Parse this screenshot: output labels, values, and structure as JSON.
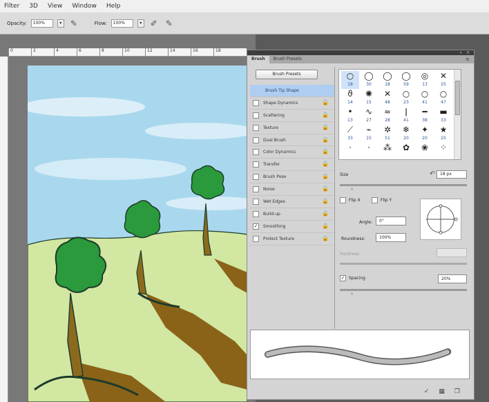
{
  "menubar": {
    "items": [
      "Filter",
      "3D",
      "View",
      "Window",
      "Help"
    ]
  },
  "optionsbar": {
    "opacity_label": "Opacity:",
    "opacity_value": "100%",
    "flow_label": "Flow:",
    "flow_value": "100%"
  },
  "ruler": {
    "marks": [
      "0",
      "2",
      "4",
      "6",
      "8",
      "10",
      "12",
      "14",
      "16",
      "18"
    ]
  },
  "panel": {
    "tabs": [
      "Brush",
      "Brush Presets"
    ],
    "presets_button": "Brush Presets",
    "settings": [
      {
        "label": "Brush Tip Shape",
        "checked": false,
        "lock": false,
        "selected": true
      },
      {
        "label": "Shape Dynamics",
        "checked": false,
        "lock": true
      },
      {
        "label": "Scattering",
        "checked": false,
        "lock": true
      },
      {
        "label": "Texture",
        "checked": false,
        "lock": true
      },
      {
        "label": "Dual Brush",
        "checked": false,
        "lock": true
      },
      {
        "label": "Color Dynamics",
        "checked": false,
        "lock": true
      },
      {
        "label": "Transfer",
        "checked": false,
        "lock": true
      },
      {
        "label": "Brush Pose",
        "checked": false,
        "lock": true
      },
      {
        "label": "Noise",
        "checked": false,
        "lock": true
      },
      {
        "label": "Wet Edges",
        "checked": false,
        "lock": true
      },
      {
        "label": "Build-up",
        "checked": false,
        "lock": true
      },
      {
        "label": "Smoothing",
        "checked": true,
        "lock": true
      },
      {
        "label": "Protect Texture",
        "checked": false,
        "lock": true
      }
    ],
    "tips": [
      {
        "g": "○",
        "n": "18"
      },
      {
        "g": "◯",
        "n": "30"
      },
      {
        "g": "◯",
        "n": "18"
      },
      {
        "g": "◯",
        "n": "59"
      },
      {
        "g": "◎",
        "n": "13"
      },
      {
        "g": "✕",
        "n": "25"
      },
      {
        "g": "ϑ",
        "n": "14"
      },
      {
        "g": "✺",
        "n": "15"
      },
      {
        "g": "✕",
        "n": "48"
      },
      {
        "g": "○",
        "n": "23"
      },
      {
        "g": "○",
        "n": "41"
      },
      {
        "g": "○",
        "n": "47"
      },
      {
        "g": "•",
        "n": "13"
      },
      {
        "g": "∿",
        "n": "27"
      },
      {
        "g": "≈",
        "n": "28"
      },
      {
        "g": "ǀ",
        "n": "41"
      },
      {
        "g": "━",
        "n": "38"
      },
      {
        "g": "▬",
        "n": "33"
      },
      {
        "g": "⟋",
        "n": "33"
      },
      {
        "g": "⌁",
        "n": "15"
      },
      {
        "g": "✲",
        "n": "51"
      },
      {
        "g": "❄",
        "n": "20"
      },
      {
        "g": "✦",
        "n": "20"
      },
      {
        "g": "★",
        "n": "25"
      },
      {
        "g": "·",
        "n": ""
      },
      {
        "g": "·",
        "n": ""
      },
      {
        "g": "⁂",
        "n": ""
      },
      {
        "g": "✿",
        "n": ""
      },
      {
        "g": "❀",
        "n": ""
      },
      {
        "g": "⁘",
        "n": ""
      }
    ],
    "size_label": "Size",
    "size_value": "18 px",
    "flip_x": "Flip X",
    "flip_y": "Flip Y",
    "angle_label": "Angle:",
    "angle_value": "0°",
    "roundness_label": "Roundness:",
    "roundness_value": "100%",
    "hardness_label": "Hardness",
    "spacing_label": "Spacing",
    "spacing_value": "20%",
    "spacing_checked": "✓"
  },
  "colors": {
    "sky": "#a9d8ee",
    "grass": "#d2e7a1",
    "tree_green": "#2a9a3c",
    "trunk": "#8c6a1d",
    "shadow": "#8a6318"
  }
}
